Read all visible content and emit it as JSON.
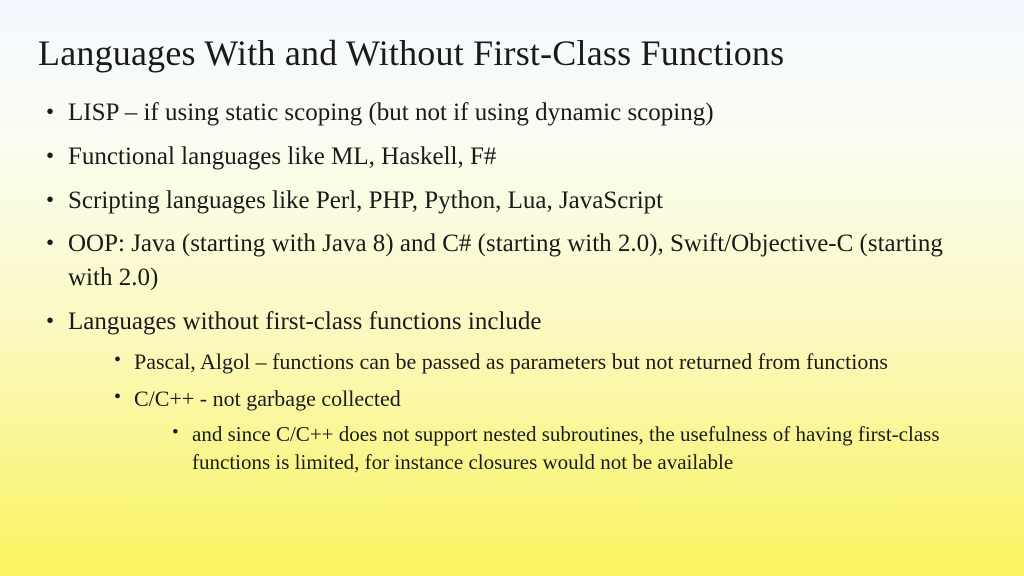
{
  "title": "Languages With and Without First-Class Functions",
  "bullets": {
    "b1": "LISP – if using static scoping (but not if using dynamic scoping)",
    "b2": "Functional languages like ML, Haskell, F#",
    "b3": "Scripting languages like Perl, PHP, Python, Lua, JavaScript",
    "b4": "OOP:  Java (starting with Java 8) and C# (starting with 2.0), Swift/Objective-C (starting with 2.0)",
    "b5": "Languages without first-class functions include",
    "b5_1": "Pascal, Algol – functions can be passed as parameters but not returned from functions",
    "b5_2": "C/C++ - not garbage collected",
    "b5_2_1": "and since C/C++ does not support nested subroutines, the usefulness of having first-class functions is limited, for instance closures would not be available"
  }
}
